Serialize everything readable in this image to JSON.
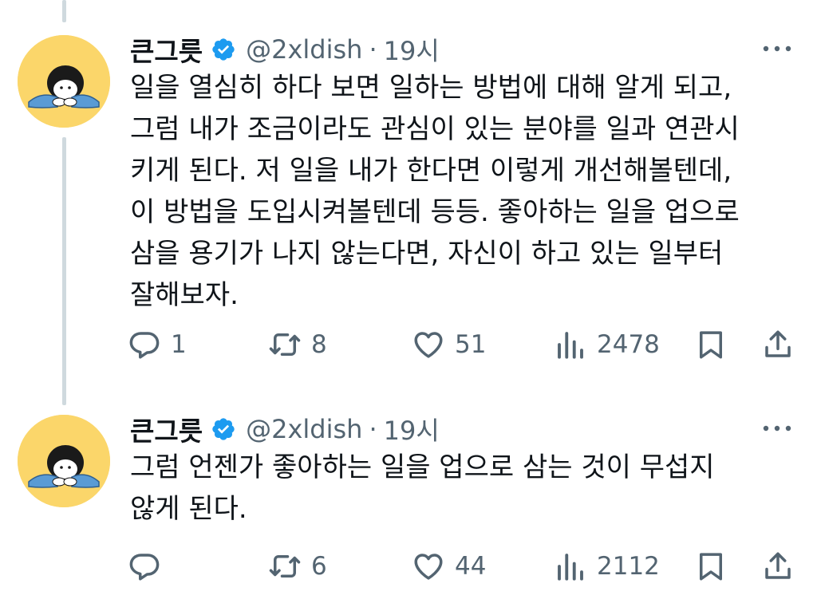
{
  "tweets": [
    {
      "author": {
        "name": "큰그릇",
        "handle": "@2xldish"
      },
      "separator": "·",
      "time": "19시",
      "lines": [
        "일을 열심히 하다 보면 일하는 방법에 대해 알게 되고,",
        "그럼 내가 조금이라도 관심이 있는 분야를 일과 연관시",
        "키게 된다. 저 일을 내가 한다면 이렇게 개선해볼텐데,",
        "이 방법을 도입시켜볼텐데 등등. 좋아하는 일을 업으로",
        "삼을 용기가 나지 않는다면, 자신이 하고 있는 일부터",
        "잘해보자."
      ],
      "stats": {
        "replies": "1",
        "reposts": "8",
        "likes": "51",
        "views": "2478"
      }
    },
    {
      "author": {
        "name": "큰그릇",
        "handle": "@2xldish"
      },
      "separator": "·",
      "time": "19시",
      "lines": [
        "그럼 언젠가 좋아하는 일을 업으로 삼는 것이 무섭지",
        "않게 된다."
      ],
      "stats": {
        "replies": "",
        "reposts": "6",
        "likes": "44",
        "views": "2112"
      }
    }
  ],
  "icons": {
    "verified": "verified-badge-icon",
    "more": "more-dots-icon",
    "reply": "reply-bubble-icon",
    "repost": "repost-arrows-icon",
    "like": "heart-icon",
    "views": "views-bars-icon",
    "bookmark": "bookmark-icon",
    "share": "share-upload-icon"
  },
  "colors": {
    "verified": "#1d9bf0",
    "secondary_text": "#536471",
    "avatar_bg": "#fbd66a",
    "thread_line": "#cfd9de"
  }
}
